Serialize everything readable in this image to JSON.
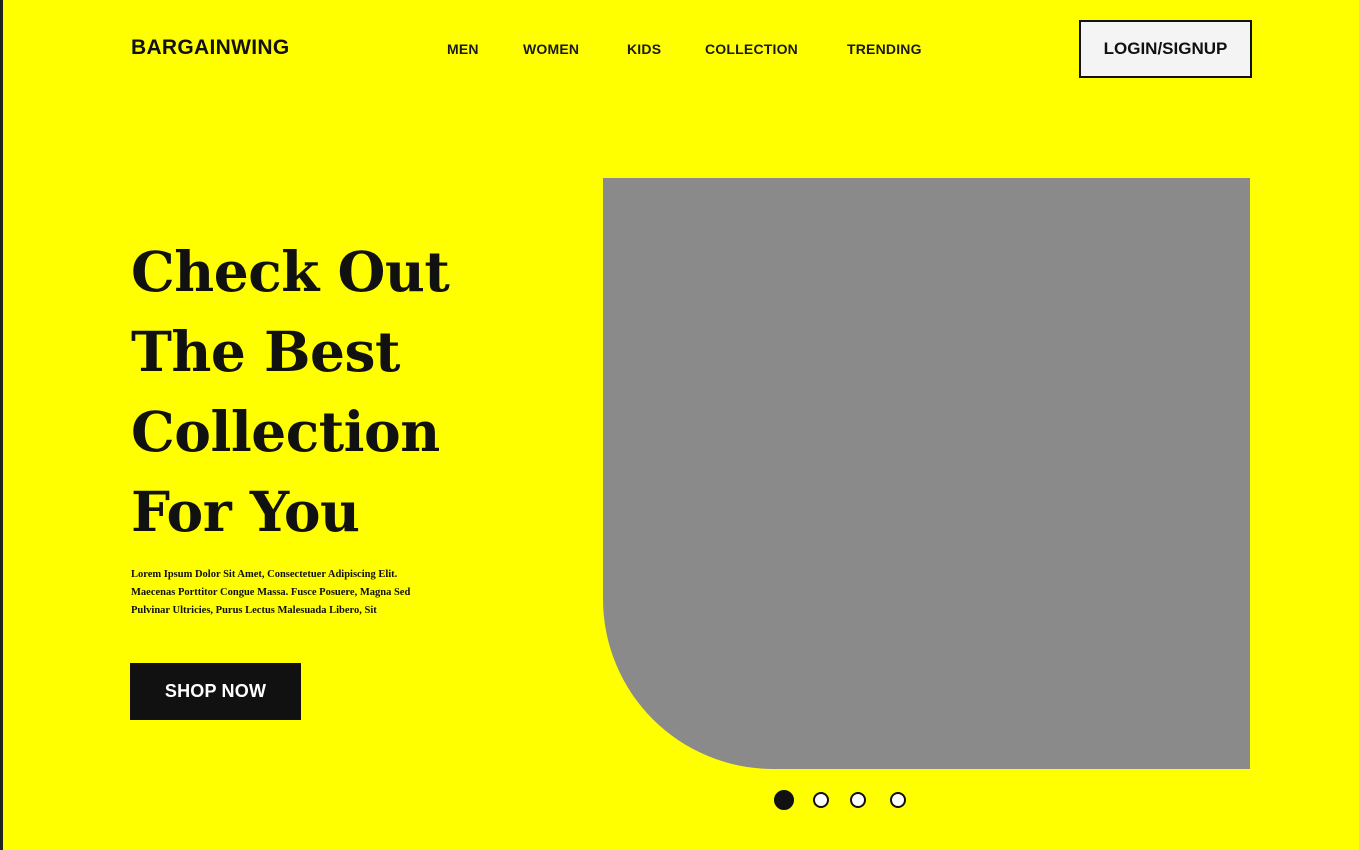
{
  "header": {
    "brand": "BARGAINWING",
    "nav": [
      {
        "label": "MEN"
      },
      {
        "label": "WOMEN"
      },
      {
        "label": "KIDS"
      },
      {
        "label": "COLLECTION"
      },
      {
        "label": "TRENDING"
      }
    ],
    "login_label": "LOGIN/SIGNUP"
  },
  "hero": {
    "title_lines": [
      "Check  Out",
      "The Best",
      "Collection",
      "For You"
    ],
    "description": "Lorem Ipsum Dolor Sit Amet, Consectetuer Adipiscing Elit. Maecenas Porttitor Congue Massa. Fusce Posuere, Magna Sed Pulvinar Ultricies, Purus Lectus Malesuada Libero, Sit",
    "cta_label": "SHOP NOW"
  },
  "carousel": {
    "slide_count": 4,
    "active_index": 0
  },
  "colors": {
    "background": "#ffff00",
    "text": "#111111",
    "image_placeholder": "#8a8a8a",
    "button_bg": "#111111",
    "button_text": "#ffffff"
  }
}
